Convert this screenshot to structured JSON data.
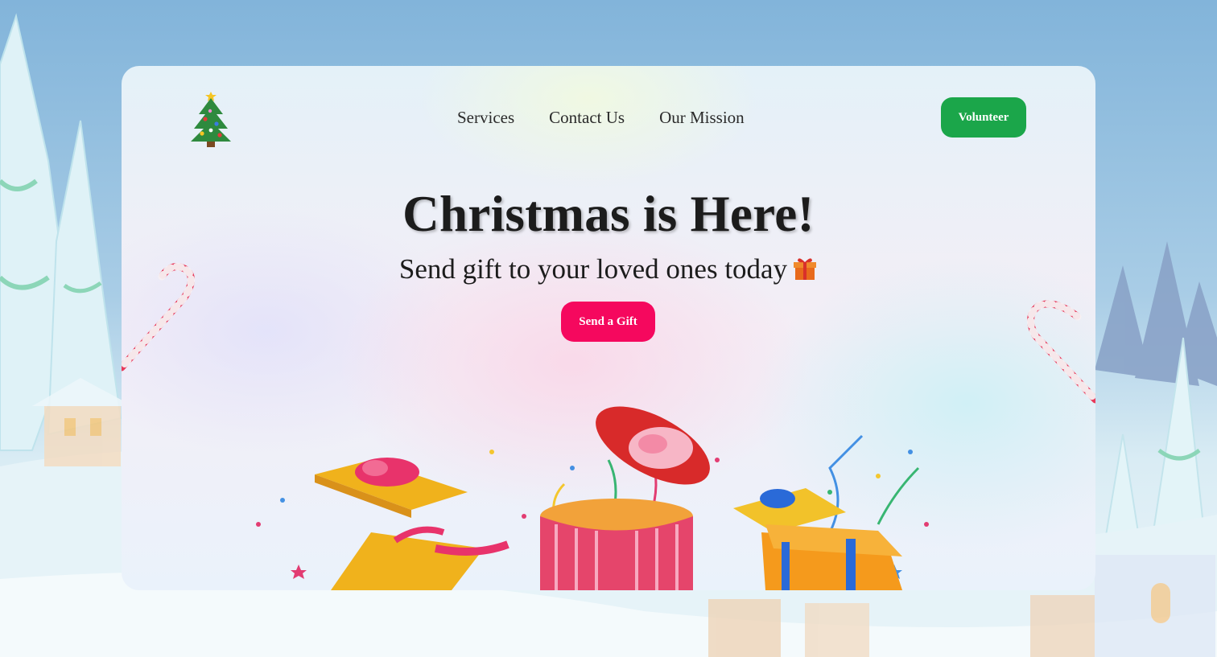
{
  "nav": {
    "items": [
      {
        "label": "Services"
      },
      {
        "label": "Contact Us"
      },
      {
        "label": "Our Mission"
      }
    ],
    "volunteer_label": "Volunteer"
  },
  "hero": {
    "title": "Christmas is Here!",
    "subtitle": "Send gift to your loved ones today",
    "cta_label": "Send a Gift"
  },
  "icons": {
    "logo": "christmas-tree-icon",
    "subtitle_emoji": "gift-icon"
  },
  "colors": {
    "volunteer_button": "#1ba64a",
    "cta_button": "#f5085e",
    "title_text": "#1c1c1c"
  }
}
